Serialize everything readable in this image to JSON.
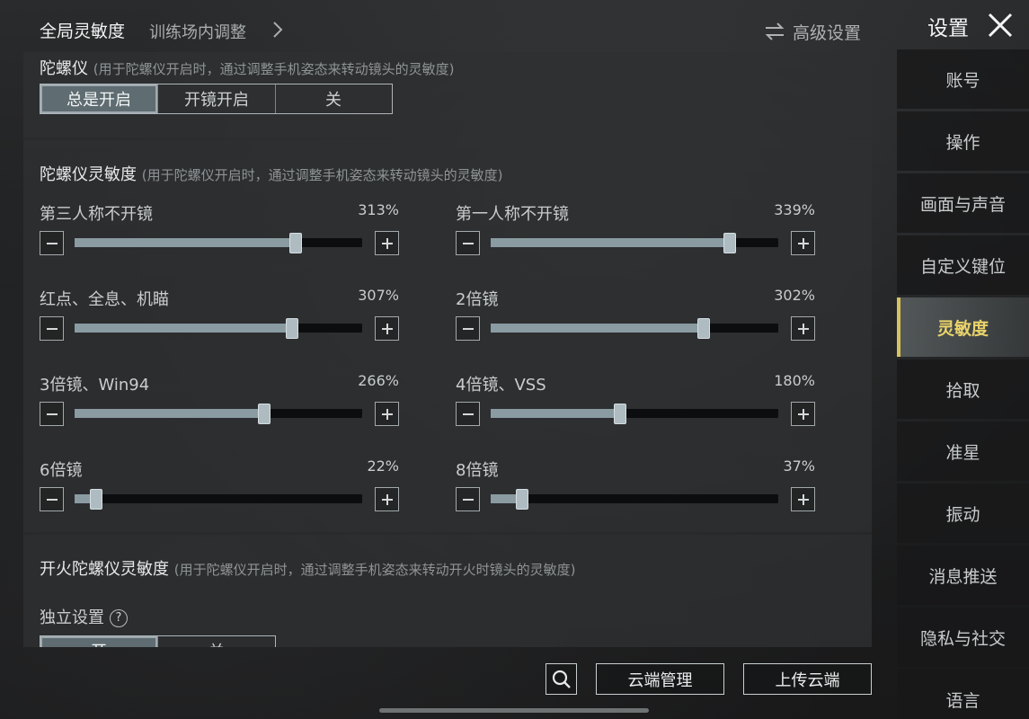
{
  "header": {
    "tab_active": "全局灵敏度",
    "tab_secondary": "训练场内调整",
    "advanced": "高级设置",
    "settings_title": "设置"
  },
  "gyro": {
    "title": "陀螺仪",
    "desc": "(用于陀螺仪开启时，通过调整手机姿态来转动镜头的灵敏度)",
    "options": [
      "总是开启",
      "开镜开启",
      "关"
    ],
    "selected": "总是开启"
  },
  "gyro_sensitivity": {
    "title": "陀螺仪灵敏度",
    "desc": "(用于陀螺仪开启时，通过调整手机姿态来转动镜头的灵敏度)",
    "sliders": [
      {
        "label": "第三人称不开镜",
        "value": "313%",
        "fraction": 0.77
      },
      {
        "label": "第一人称不开镜",
        "value": "339%",
        "fraction": 0.83
      },
      {
        "label": "红点、全息、机瞄",
        "value": "307%",
        "fraction": 0.755
      },
      {
        "label": "2倍镜",
        "value": "302%",
        "fraction": 0.74
      },
      {
        "label": "3倍镜、Win94",
        "value": "266%",
        "fraction": 0.66
      },
      {
        "label": "4倍镜、VSS",
        "value": "180%",
        "fraction": 0.45
      },
      {
        "label": "6倍镜",
        "value": "22%",
        "fraction": 0.075
      },
      {
        "label": "8倍镜",
        "value": "37%",
        "fraction": 0.11
      }
    ]
  },
  "fire_gyro": {
    "title": "开火陀螺仪灵敏度",
    "desc": "(用于陀螺仪开启时，通过调整手机姿态来转动开火时镜头的灵敏度)",
    "independent_label": "独立设置",
    "options": [
      "开",
      "关"
    ],
    "selected": "开"
  },
  "sidebar": {
    "items": [
      "账号",
      "操作",
      "画面与声音",
      "自定义键位",
      "灵敏度",
      "拾取",
      "准星",
      "振动",
      "消息推送",
      "隐私与社交",
      "语言"
    ],
    "active": "灵敏度"
  },
  "footer": {
    "cloud_manage": "云端管理",
    "upload_cloud": "上传云端"
  },
  "colors": {
    "accent": "#d7c35c",
    "slider_fill": "#8a9ba2"
  }
}
